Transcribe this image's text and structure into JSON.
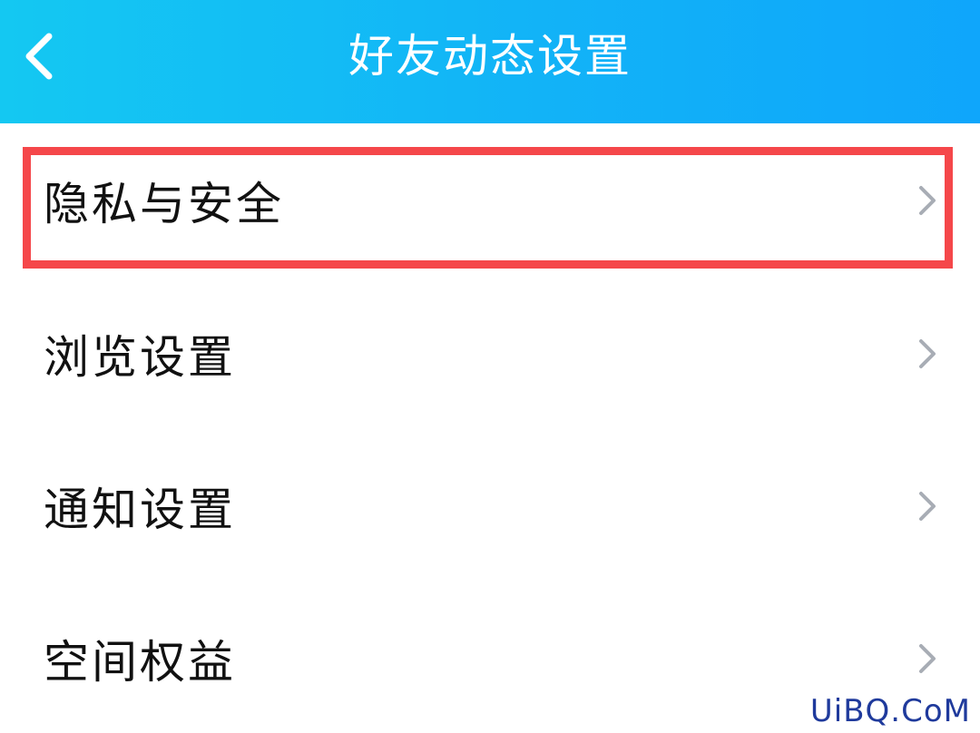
{
  "header": {
    "title": "好友动态设置",
    "back_icon": "chevron-left-icon",
    "background": "#12b3f7"
  },
  "list": {
    "items": [
      {
        "label": "隐私与安全",
        "icon": "chevron-right-icon"
      },
      {
        "label": "浏览设置",
        "icon": "chevron-right-icon"
      },
      {
        "label": "通知设置",
        "icon": "chevron-right-icon"
      },
      {
        "label": "空间权益",
        "icon": "chevron-right-icon"
      }
    ]
  },
  "highlight": {
    "color": "#f5474a"
  },
  "watermark": {
    "text": "UiBQ.CoM"
  }
}
